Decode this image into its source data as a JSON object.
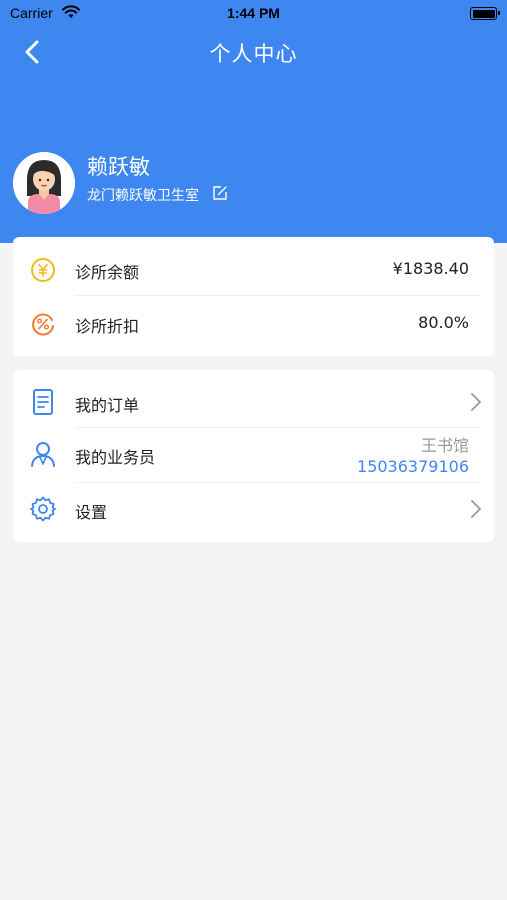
{
  "status_bar": {
    "carrier": "Carrier",
    "time": "1:44 PM"
  },
  "nav": {
    "title": "个人中心",
    "back_icon": "chevron-left-icon"
  },
  "profile": {
    "name": "赖跃敏",
    "clinic": "龙门赖跃敏卫生室",
    "edit_icon": "edit-icon"
  },
  "account": {
    "balance_label": "诊所余额",
    "balance_value": "¥1838.40",
    "discount_label": "诊所折扣",
    "discount_value": "80.0%"
  },
  "menu": {
    "orders_label": "我的订单",
    "salesperson_label": "我的业务员",
    "salesperson_name": "王书馆",
    "salesperson_phone": "15036379106",
    "settings_label": "设置"
  },
  "colors": {
    "primary": "#3f87f0",
    "coin": "#f5b81c",
    "discount": "#f07a2a",
    "page_bg": "#f4f4f4"
  }
}
